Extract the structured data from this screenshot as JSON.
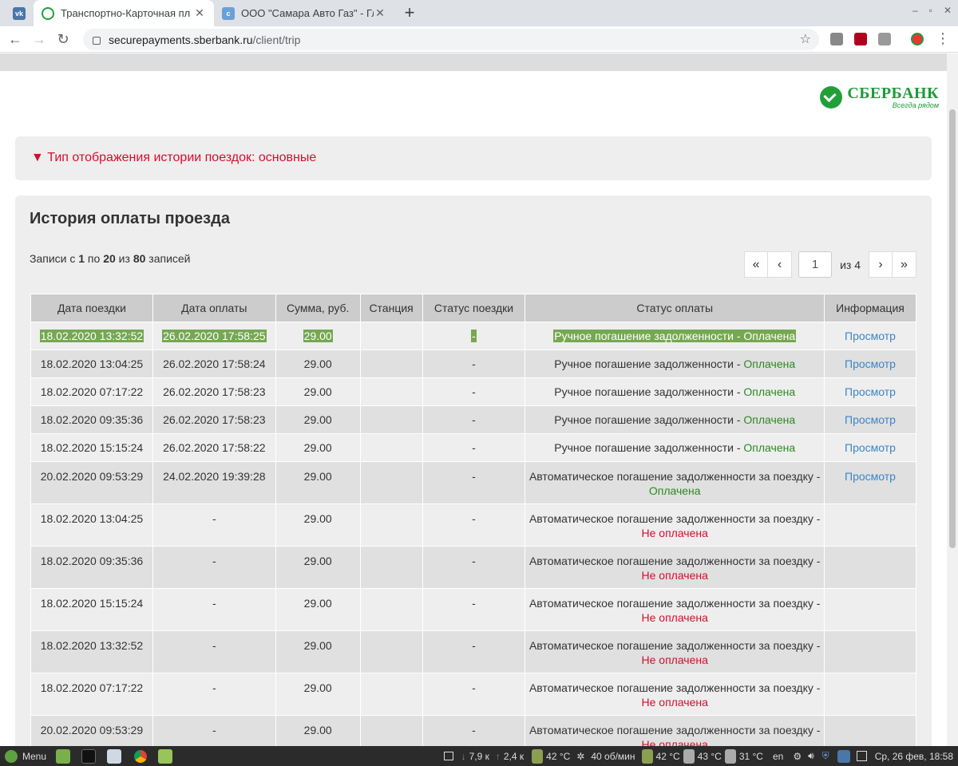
{
  "browser": {
    "tabs": [
      {
        "favicon": "vk-icon",
        "title": ""
      },
      {
        "favicon": "sberbank-icon",
        "title": "Транспортно-Карточная пл"
      },
      {
        "favicon": "autogas-icon",
        "title": "ООО \"Самара Авто Газ\" - Гла"
      }
    ],
    "url_host": "securepayments.sberbank.ru",
    "url_path": "/client/trip"
  },
  "logo": {
    "name": "СБЕРБАНК",
    "slogan": "Всегда рядом",
    "color": "#21a038"
  },
  "display_toggle": "▼ Тип отображения истории поездок: основные",
  "history": {
    "title": "История оплаты проезда",
    "records_prefix": "Записи с ",
    "records_from": "1",
    "records_mid1": " по ",
    "records_to": "20",
    "records_mid2": " из ",
    "records_total": "80",
    "records_suffix": " записей",
    "pager": {
      "first": "«",
      "prev": "‹",
      "page": "1",
      "of": "из 4",
      "next": "›",
      "last": "»"
    },
    "columns": [
      "Дата поездки",
      "Дата оплаты",
      "Сумма, руб.",
      "Станция",
      "Статус поездки",
      "Статус оплаты",
      "Информация"
    ],
    "rows": [
      {
        "trip_date": "18.02.2020 13:32:52",
        "pay_date": "26.02.2020 17:58:25",
        "sum": "29.00",
        "station": "",
        "trip_status": "-",
        "pay_text": "Ручное погашение задолженности - ",
        "pay_status": "Оплачена",
        "info": "Просмотр"
      },
      {
        "trip_date": "18.02.2020 13:04:25",
        "pay_date": "26.02.2020 17:58:24",
        "sum": "29.00",
        "station": "",
        "trip_status": "-",
        "pay_text": "Ручное погашение задолженности - ",
        "pay_status": "Оплачена",
        "info": "Просмотр"
      },
      {
        "trip_date": "18.02.2020 07:17:22",
        "pay_date": "26.02.2020 17:58:23",
        "sum": "29.00",
        "station": "",
        "trip_status": "-",
        "pay_text": "Ручное погашение задолженности - ",
        "pay_status": "Оплачена",
        "info": "Просмотр"
      },
      {
        "trip_date": "18.02.2020 09:35:36",
        "pay_date": "26.02.2020 17:58:23",
        "sum": "29.00",
        "station": "",
        "trip_status": "-",
        "pay_text": "Ручное погашение задолженности - ",
        "pay_status": "Оплачена",
        "info": "Просмотр"
      },
      {
        "trip_date": "18.02.2020 15:15:24",
        "pay_date": "26.02.2020 17:58:22",
        "sum": "29.00",
        "station": "",
        "trip_status": "-",
        "pay_text": "Ручное погашение задолженности - ",
        "pay_status": "Оплачена",
        "info": "Просмотр"
      },
      {
        "trip_date": "20.02.2020 09:53:29",
        "pay_date": "24.02.2020 19:39:28",
        "sum": "29.00",
        "station": "",
        "trip_status": "-",
        "pay_text": "Автоматическое погашение задолженности за поездку -",
        "pay_status": "Оплачена",
        "info": "Просмотр"
      },
      {
        "trip_date": "18.02.2020 13:04:25",
        "pay_date": "-",
        "sum": "29.00",
        "station": "",
        "trip_status": "-",
        "pay_text": "Автоматическое погашение задолженности за поездку -",
        "pay_status": "Не оплачена",
        "info": ""
      },
      {
        "trip_date": "18.02.2020 09:35:36",
        "pay_date": "-",
        "sum": "29.00",
        "station": "",
        "trip_status": "-",
        "pay_text": "Автоматическое погашение задолженности за поездку -",
        "pay_status": "Не оплачена",
        "info": ""
      },
      {
        "trip_date": "18.02.2020 15:15:24",
        "pay_date": "-",
        "sum": "29.00",
        "station": "",
        "trip_status": "-",
        "pay_text": "Автоматическое погашение задолженности за поездку -",
        "pay_status": "Не оплачена",
        "info": ""
      },
      {
        "trip_date": "18.02.2020 13:32:52",
        "pay_date": "-",
        "sum": "29.00",
        "station": "",
        "trip_status": "-",
        "pay_text": "Автоматическое погашение задолженности за поездку -",
        "pay_status": "Не оплачена",
        "info": ""
      },
      {
        "trip_date": "18.02.2020 07:17:22",
        "pay_date": "-",
        "sum": "29.00",
        "station": "",
        "trip_status": "-",
        "pay_text": "Автоматическое погашение задолженности за поездку -",
        "pay_status": "Не оплачена",
        "info": ""
      },
      {
        "trip_date": "20.02.2020 09:53:29",
        "pay_date": "-",
        "sum": "29.00",
        "station": "",
        "trip_status": "-",
        "pay_text": "Автоматическое погашение задолженности за поездку -",
        "pay_status": "Не оплачена",
        "info": ""
      }
    ],
    "colors": {
      "paid": "#2a8a20",
      "unpaid": "#d50e2e",
      "link": "#3a86c8",
      "highlight": "#75a850"
    }
  },
  "taskbar": {
    "menu": "Menu",
    "net_down": "7,9 к",
    "net_up": "2,4 к",
    "temp1": "42 °C",
    "fan": "40 об/мин",
    "temp2": "42 °C",
    "temp3": "43 °C",
    "temp4": "31 °C",
    "lang": "en",
    "clock": "Ср, 26 фев, 18:58"
  }
}
